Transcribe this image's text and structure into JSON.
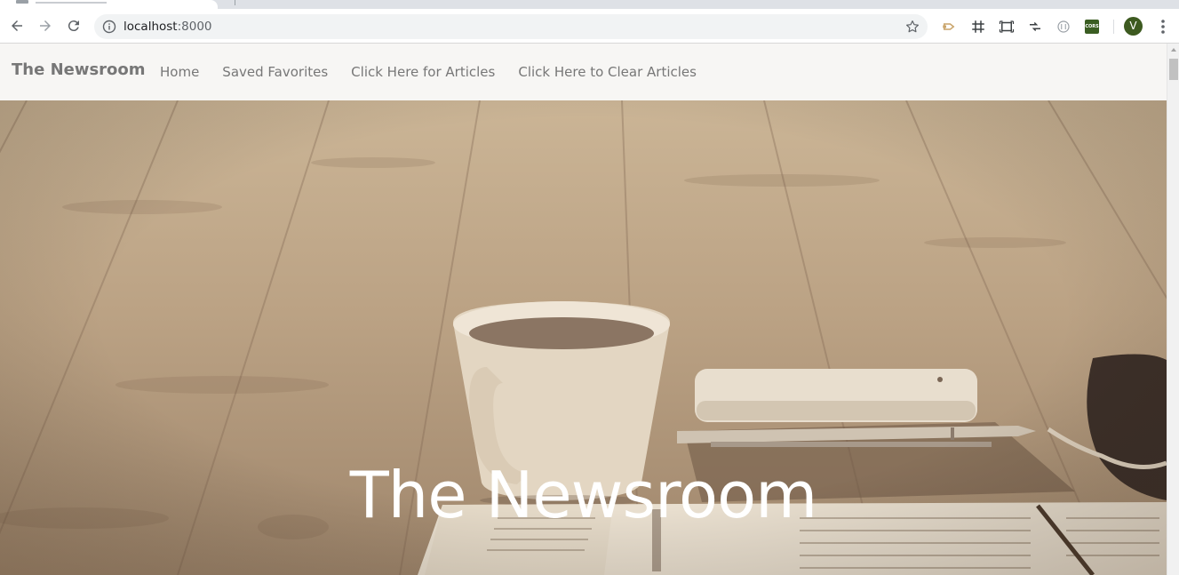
{
  "browser": {
    "url_host": "localhost",
    "url_port": ":8000",
    "profile_initial": "V",
    "extension_badge": "CORS",
    "icons": [
      "back-icon",
      "forward-icon",
      "reload-icon",
      "info-icon",
      "star-icon",
      "menu-icon"
    ]
  },
  "site": {
    "brand": "The Newsroom",
    "nav": [
      {
        "label": "Home"
      },
      {
        "label": "Saved Favorites"
      },
      {
        "label": "Click Here for Articles"
      },
      {
        "label": "Click Here to Clear Articles"
      }
    ]
  },
  "hero": {
    "title": "The Newsroom"
  },
  "colors": {
    "navbar_bg": "#f7f6f4",
    "nav_text": "#777777",
    "hero_text": "#ffffff",
    "hero_tone": "#c2a987"
  }
}
